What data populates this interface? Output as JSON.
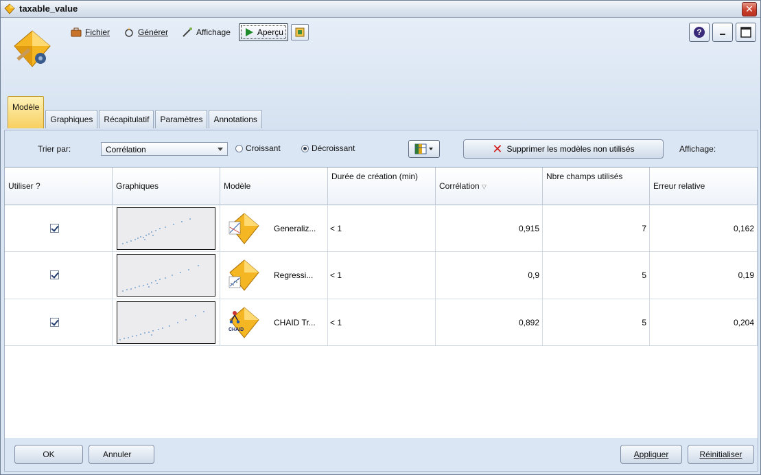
{
  "window": {
    "title": "taxable_value"
  },
  "toolbar": {
    "fichier": "Fichier",
    "generer": "Générer",
    "affichage": "Affichage",
    "apercu": "Aperçu"
  },
  "tabs": [
    {
      "label": "Modèle",
      "active": true
    },
    {
      "label": "Graphiques",
      "active": false
    },
    {
      "label": "Récapitulatif",
      "active": false
    },
    {
      "label": "Paramètres",
      "active": false
    },
    {
      "label": "Annotations",
      "active": false
    }
  ],
  "sort": {
    "label": "Trier par:",
    "selected": "Corrélation",
    "ascending": "Croissant",
    "descending": "Décroissant",
    "selected_order": "Décroissant",
    "delete_unused": "Supprimer les modèles non utilisés",
    "view_label": "Affichage:"
  },
  "table": {
    "headers": [
      "Utiliser ?",
      "Graphiques",
      "Modèle",
      "Durée de création (min)",
      "Corrélation",
      "Nbre champs utilisés",
      "Erreur relative"
    ],
    "rows": [
      {
        "use": true,
        "model": "Generaliz...",
        "icon": "generalized-linear-model-icon",
        "duration": "< 1",
        "correlation": "0,915",
        "fields": "7",
        "error": "0,162"
      },
      {
        "use": true,
        "model": "Regressi...",
        "icon": "regression-model-icon",
        "duration": "< 1",
        "correlation": "0,9",
        "fields": "5",
        "error": "0,19"
      },
      {
        "use": true,
        "model": "CHAID Tr...",
        "icon": "chaid-tree-model-icon",
        "chaid_text": "CHAID",
        "duration": "< 1",
        "correlation": "0,892",
        "fields": "5",
        "error": "0,204"
      }
    ]
  },
  "buttons": {
    "ok": "OK",
    "cancel": "Annuler",
    "apply": "Appliquer",
    "reset": "Réinitialiser"
  },
  "colors": {
    "accent_tab": "#f7cf5f",
    "background": "#dbe6f4",
    "close": "#c9402c"
  }
}
